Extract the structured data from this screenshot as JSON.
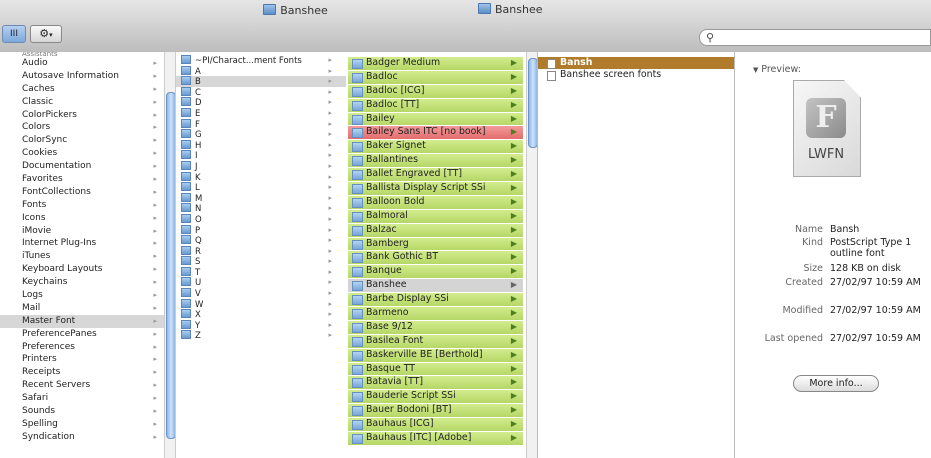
{
  "window1": {
    "title": "Banshee",
    "view_label": "III",
    "action_icon": "gear-icon",
    "col1_top_partial": "Assistants",
    "col1_items": [
      "Audio",
      "Autosave Information",
      "Caches",
      "Classic",
      "ColorPickers",
      "Colors",
      "ColorSync",
      "Cookies",
      "Documentation",
      "Favorites",
      "FontCollections",
      "Fonts",
      "Icons",
      "iMovie",
      "Internet Plug-Ins",
      "iTunes",
      "Keyboard Layouts",
      "Keychains",
      "Logs",
      "Mail",
      "Master Font",
      "PreferencePanes",
      "Preferences",
      "Printers",
      "Receipts",
      "Recent Servers",
      "Safari",
      "Sounds",
      "Spelling",
      "Syndication"
    ],
    "col1_selected": "Master Font",
    "col2_items": [
      "~PI/Charact...ment Fonts",
      "A",
      "B",
      "C",
      "D",
      "E",
      "F",
      "G",
      "H",
      "I",
      "J",
      "K",
      "L",
      "M",
      "N",
      "O",
      "P",
      "Q",
      "R",
      "S",
      "T",
      "U",
      "V",
      "W",
      "X",
      "Y",
      "Z"
    ],
    "col2_selected": "B"
  },
  "window2": {
    "title": "Banshee",
    "search_icon": "search-icon",
    "fonts": [
      {
        "name": "Badger Medium",
        "state": "ok"
      },
      {
        "name": "Badloc",
        "state": "ok"
      },
      {
        "name": "Badloc [ICG]",
        "state": "ok"
      },
      {
        "name": "Badloc [TT]",
        "state": "ok"
      },
      {
        "name": "Bailey",
        "state": "ok"
      },
      {
        "name": "Bailey Sans ITC [no book]",
        "state": "error"
      },
      {
        "name": "Baker Signet",
        "state": "ok"
      },
      {
        "name": "Ballantines",
        "state": "ok"
      },
      {
        "name": "Ballet Engraved [TT]",
        "state": "ok"
      },
      {
        "name": "Ballista Display Script SSi",
        "state": "ok"
      },
      {
        "name": "Balloon Bold",
        "state": "ok"
      },
      {
        "name": "Balmoral",
        "state": "ok"
      },
      {
        "name": "Balzac",
        "state": "ok"
      },
      {
        "name": "Bamberg",
        "state": "ok"
      },
      {
        "name": "Bank Gothic BT",
        "state": "ok"
      },
      {
        "name": "Banque",
        "state": "ok"
      },
      {
        "name": "Banshee",
        "state": "selected"
      },
      {
        "name": "Barbe Display SSi",
        "state": "ok"
      },
      {
        "name": "Barmeno",
        "state": "ok"
      },
      {
        "name": "Base 9/12",
        "state": "ok"
      },
      {
        "name": "Basilea Font",
        "state": "ok"
      },
      {
        "name": "Baskerville BE [Berthold]",
        "state": "ok"
      },
      {
        "name": "Basque TT",
        "state": "ok"
      },
      {
        "name": "Batavia [TT]",
        "state": "ok"
      },
      {
        "name": "Bauderie Script SSi",
        "state": "ok"
      },
      {
        "name": "Bauer Bodoni [BT]",
        "state": "ok"
      },
      {
        "name": "Bauhaus [ICG]",
        "state": "ok"
      },
      {
        "name": "Bauhaus [ITC] [Adobe]",
        "state": "ok"
      }
    ],
    "files": [
      "Bansh",
      "Banshee screen fonts"
    ],
    "files_selected": "Bansh",
    "preview_label": "Preview:",
    "doc_label": "LWFN",
    "info": [
      {
        "key": "Name",
        "value": "Bansh"
      },
      {
        "key": "Kind",
        "value": "PostScript Type 1 outline font"
      },
      {
        "key": "Size",
        "value": "128 KB on disk"
      },
      {
        "key": "Created",
        "value": "27/02/97 10:59 AM"
      },
      {
        "key": "Modified",
        "value": "27/02/97 10:59 AM"
      },
      {
        "key": "Last opened",
        "value": "27/02/97 10:59 AM"
      }
    ],
    "more_info_label": "More info..."
  },
  "colors": {
    "font_ok": "#b6d766",
    "font_error": "#e46c6c",
    "selection_blue": "#b07c2c"
  }
}
